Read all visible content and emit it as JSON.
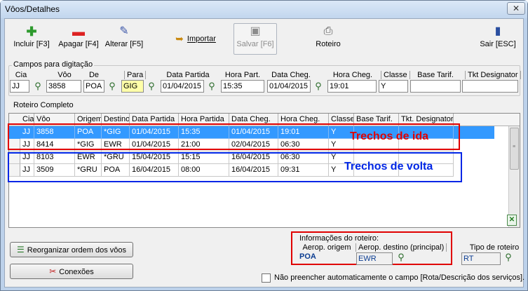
{
  "window": {
    "title": "Vôos/Detalhes",
    "close_glyph": "✕"
  },
  "toolbar": {
    "incluir": "Incluir [F3]",
    "apagar": "Apagar [F4]",
    "alterar": "Alterar [F5]",
    "importar": "Importar",
    "salvar": "Salvar [F6]",
    "roteiro": "Roteiro",
    "sair": "Sair [ESC]"
  },
  "entry": {
    "group_label": "Campos para digitação",
    "labels": {
      "cia": "Cia",
      "voo": "Vôo",
      "de": "De",
      "para": "Para",
      "data_partida": "Data Partida",
      "hora_part": "Hora Part.",
      "data_cheg": "Data Cheg.",
      "hora_cheg": "Hora Cheg.",
      "classe": "Classe",
      "base_tarif": "Base Tarif.",
      "tkt_designator": "Tkt Designator"
    },
    "values": {
      "cia": "JJ",
      "voo": "3858",
      "de": "POA",
      "para": "GIG",
      "data_partida": "01/04/2015",
      "hora_part": "15:35",
      "data_cheg": "01/04/2015",
      "hora_cheg": "19:01",
      "classe": "Y",
      "base_tarif": "",
      "tkt_designator": ""
    }
  },
  "itinerary": {
    "group_label": "Roteiro Completo",
    "columns": [
      "Cia",
      "Vôo",
      "Origem",
      "Destino",
      "Data Partida",
      "Hora Partida",
      "Data Cheg.",
      "Hora Cheg.",
      "Classe",
      "Base Tarif.",
      "Tkt. Designator"
    ],
    "rows": [
      [
        "JJ",
        "3858",
        "POA",
        "*GIG",
        "01/04/2015",
        "15:35",
        "01/04/2015",
        "19:01",
        "Y",
        "",
        ""
      ],
      [
        "JJ",
        "8414",
        "*GIG",
        "EWR",
        "01/04/2015",
        "21:00",
        "02/04/2015",
        "06:30",
        "Y",
        "",
        ""
      ],
      [
        "JJ",
        "8103",
        "EWR",
        "*GRU",
        "15/04/2015",
        "15:15",
        "16/04/2015",
        "06:30",
        "Y",
        "",
        ""
      ],
      [
        "JJ",
        "3509",
        "*GRU",
        "POA",
        "16/04/2015",
        "08:00",
        "16/04/2015",
        "09:31",
        "Y",
        "",
        ""
      ]
    ],
    "selected_row": 0,
    "annotation_outbound": "Trechos de ida",
    "annotation_return": "Trechos de volta",
    "annotation_outbound_color": "#e00000",
    "annotation_return_color": "#0026e6"
  },
  "actions": {
    "reorganizar": "Reorganizar ordem dos vôos",
    "conexoes": "Conexões"
  },
  "route_info": {
    "group_label": "Informações do roteiro:",
    "origem_label": "Aerop. origem",
    "origem_value": "POA",
    "destino_label": "Aerop. destino (principal)",
    "destino_value": "EWR",
    "tipo_label": "Tipo de roteiro",
    "tipo_value": "RT"
  },
  "footer": {
    "checkbox_label": "Não preencher automaticamente o campo [Rota/Descrição dos serviços].",
    "checkbox_checked": false
  }
}
